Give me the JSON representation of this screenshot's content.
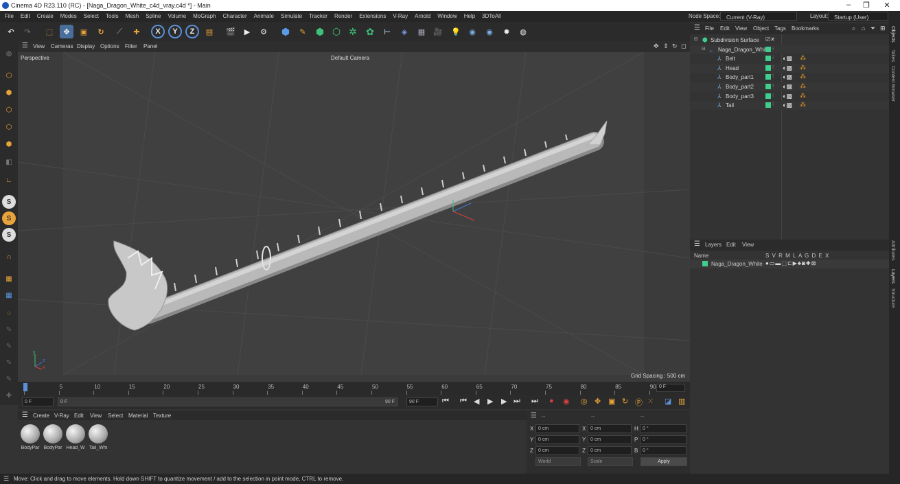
{
  "window": {
    "title": "Cinema 4D R23.110 (RC) - [Naga_Dragon_White_c4d_vray.c4d *] - Main",
    "min": "–",
    "max": "❐",
    "close": "✕"
  },
  "menu": {
    "items": [
      "File",
      "Edit",
      "Create",
      "Modes",
      "Select",
      "Tools",
      "Mesh",
      "Spline",
      "Volume",
      "MoGraph",
      "Character",
      "Animate",
      "Simulate",
      "Tracker",
      "Render",
      "Extensions",
      "V-Ray",
      "Arnold",
      "Window",
      "Help",
      "3DToAll"
    ],
    "node_space_label": "Node Space:",
    "node_space_value": "Current (V-Ray)",
    "layout_label": "Layout:",
    "layout_value": "Startup (User)"
  },
  "toolbar": {
    "x_label": "X",
    "y_label": "Y",
    "z_label": "Z"
  },
  "leftbar": {
    "s1": "S",
    "s2": "S",
    "s3": "S"
  },
  "viewport": {
    "menu": [
      "View",
      "Cameras",
      "Display",
      "Options",
      "Filter",
      "Panel"
    ],
    "label": "Perspective",
    "camera": "Default Camera",
    "grid_spacing": "Grid Spacing : 500 cm",
    "axis_y": "y",
    "axis_z": "z",
    "axis_x": "x"
  },
  "timeline": {
    "ticks": [
      "0",
      "5",
      "10",
      "15",
      "20",
      "25",
      "30",
      "35",
      "40",
      "45",
      "50",
      "55",
      "60",
      "65",
      "70",
      "75",
      "80",
      "85",
      "90"
    ],
    "current_frame": "0 F"
  },
  "transport": {
    "start": "0 F",
    "current": "0 F",
    "end1": "90 F",
    "end2": "90 F"
  },
  "materials": {
    "menu": [
      "Create",
      "V-Ray",
      "Edit",
      "View",
      "Select",
      "Material",
      "Texture"
    ],
    "items": [
      "BodyPar",
      "BodyPar",
      "Head_W",
      "Tail_Whi"
    ]
  },
  "coords": {
    "header": [
      "--",
      "--",
      "--"
    ],
    "rows": [
      {
        "a": "X",
        "av": "0 cm",
        "b": "X",
        "bv": "0 cm",
        "c": "H",
        "cv": "0 °"
      },
      {
        "a": "Y",
        "av": "0 cm",
        "b": "Y",
        "bv": "0 cm",
        "c": "P",
        "cv": "0 °"
      },
      {
        "a": "Z",
        "av": "0 cm",
        "b": "Z",
        "bv": "0 cm",
        "c": "B",
        "cv": "0 °"
      }
    ],
    "world": "World",
    "scale": "Scale",
    "apply": "Apply"
  },
  "status": "Move: Click and drag to move elements. Hold down SHIFT to quantize movement / add to the selection in point mode, CTRL to remove.",
  "objects": {
    "menu": [
      "File",
      "Edit",
      "View",
      "Object",
      "Tags",
      "Bookmarks"
    ],
    "tree": [
      {
        "label": "Subdivision Surface",
        "level": 0
      },
      {
        "label": "Naga_Dragon_White",
        "level": 1
      },
      {
        "label": "Belt",
        "level": 2
      },
      {
        "label": "Head",
        "level": 2
      },
      {
        "label": "Body_part1",
        "level": 2
      },
      {
        "label": "Body_part2",
        "level": 2
      },
      {
        "label": "Body_part3",
        "level": 2
      },
      {
        "label": "Tail",
        "level": 2
      }
    ]
  },
  "layers": {
    "menu": [
      "Layers",
      "Edit",
      "View"
    ],
    "name_header": "Name",
    "cols": "S V R M L A G D E X",
    "layer_name": "Naga_Dragon_White"
  },
  "right_tabs": [
    "Objects",
    "Takes",
    "Content Browser",
    "Attributes",
    "Layers",
    "Structure"
  ],
  "colors": {
    "accent": "#5b8fd6",
    "green_tag": "#3ecf8e",
    "orange": "#e89a2c"
  }
}
